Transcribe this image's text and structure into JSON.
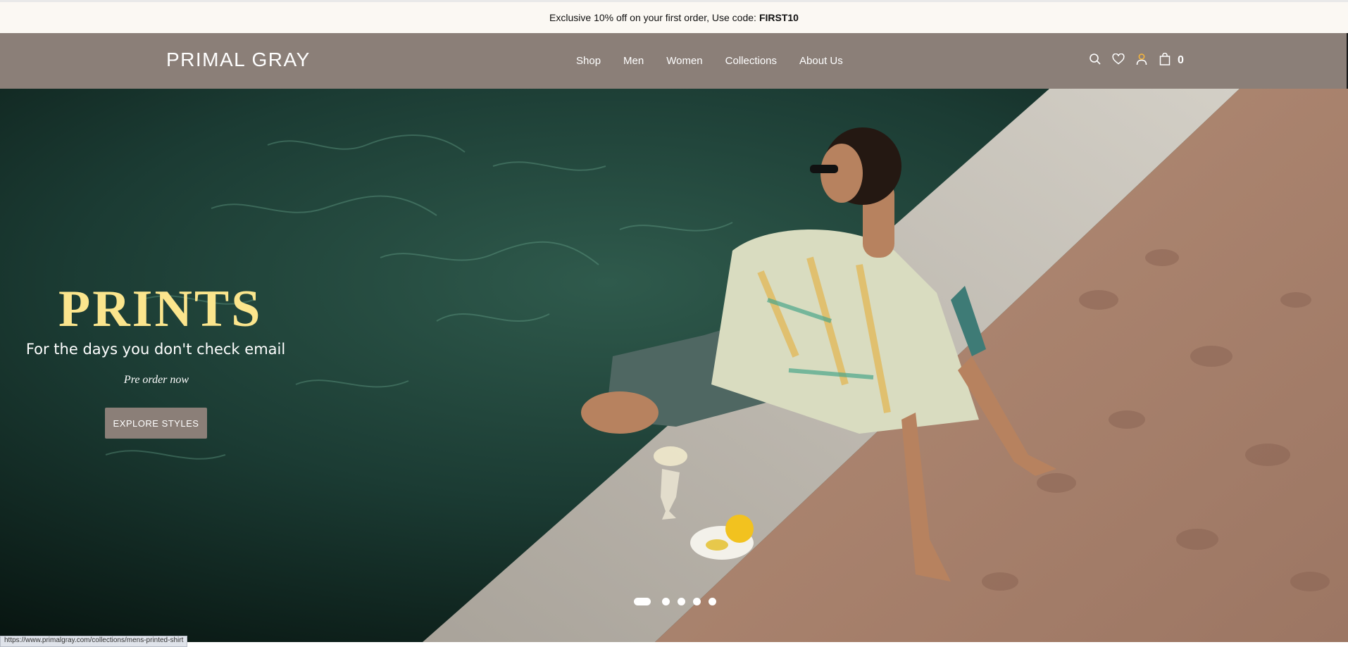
{
  "announcement": {
    "text": "Exclusive 10% off on your first order, Use code:",
    "code": "FIRST10"
  },
  "header": {
    "logo": "PRIMAL GRAY",
    "nav": [
      "Shop",
      "Men",
      "Women",
      "Collections",
      "About Us"
    ],
    "icons": [
      "search-icon",
      "heart-icon",
      "user-icon",
      "bag-icon"
    ],
    "cart_count": "0"
  },
  "hero": {
    "title": "PRINTS",
    "subtitle": "For the days you don't check email",
    "preorder": "Pre order now",
    "button": "EXPLORE STYLES",
    "slides_total": 5,
    "active_slide": 1
  },
  "status_bar": {
    "url": "https://www.primalgray.com/collections/mens-printed-shirt"
  },
  "colors": {
    "header_bg": "#8b7f78",
    "announcement_bg": "#fbf8f3",
    "hero_title": "#fbe58d",
    "button_bg": "#8b7f78"
  }
}
